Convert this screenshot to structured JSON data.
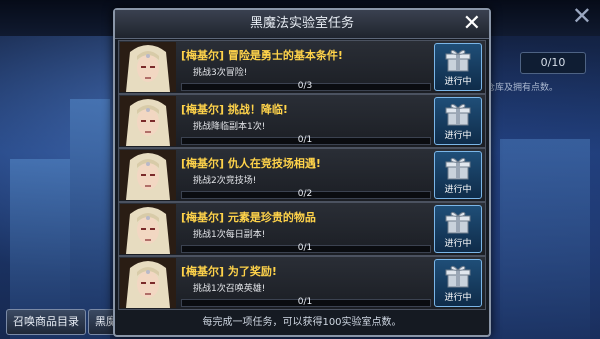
{
  "background": {
    "counter_text": "0/10",
    "hint_text": "仓库及拥有点数。",
    "bottom_buttons": [
      "召唤商品目录",
      "黑魔"
    ]
  },
  "modal": {
    "title": "黑魔法实验室任务",
    "close_symbol": "✕",
    "footer_text": "每完成一项任务，可以获得100实验室点数。"
  },
  "quests": [
    {
      "title": "[梅基尔] 冒险是勇士的基本条件!",
      "desc": "挑战3次冒险!",
      "progress_text": "0/3",
      "progress": 0,
      "status": "进行中"
    },
    {
      "title": "[梅基尔] 挑战！降临!",
      "desc": "挑战降临副本1次!",
      "progress_text": "0/1",
      "progress": 0,
      "status": "进行中"
    },
    {
      "title": "[梅基尔] 仇人在竞技场相遇!",
      "desc": "挑战2次竞技场!",
      "progress_text": "0/2",
      "progress": 0,
      "status": "进行中"
    },
    {
      "title": "[梅基尔] 元素是珍贵的物品",
      "desc": "挑战1次每日副本!",
      "progress_text": "0/1",
      "progress": 0,
      "status": "进行中"
    },
    {
      "title": "[梅基尔] 为了奖励!",
      "desc": "挑战1次召唤英雄!",
      "progress_text": "0/1",
      "progress": 0,
      "status": "进行中"
    }
  ]
}
